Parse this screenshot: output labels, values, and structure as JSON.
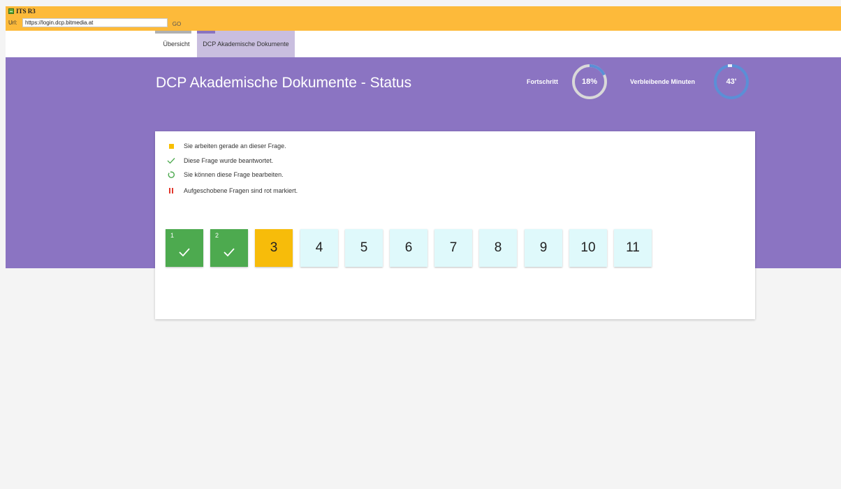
{
  "app": {
    "title": "ITS R3",
    "url_label": "Url:",
    "url_value": "https://login.dcp.bitmedia.at",
    "go_label": "GO"
  },
  "nav": {
    "tabs": [
      {
        "label": "Übersicht"
      },
      {
        "label": "DCP Akademische Dokumente",
        "active": true
      }
    ]
  },
  "header": {
    "title": "DCP Akademische Dokumente - Status",
    "progress_label": "Fortschritt",
    "progress_value": "18%",
    "progress_fraction": 0.18,
    "minutes_label": "Verbleibende Minuten",
    "minutes_value": "43'"
  },
  "legend": [
    {
      "icon": "yellow-square-icon",
      "text": "Sie arbeiten gerade an dieser Frage."
    },
    {
      "icon": "check-icon",
      "text": "Diese Frage wurde beantwortet."
    },
    {
      "icon": "redo-icon",
      "text": "Sie können diese Frage bearbeiten."
    },
    {
      "icon": "pause-icon",
      "text": "Aufgeschobene Fragen sind rot markiert."
    }
  ],
  "questions": [
    {
      "num": "1",
      "status": "answered"
    },
    {
      "num": "2",
      "status": "answered"
    },
    {
      "num": "3",
      "status": "current"
    },
    {
      "num": "4",
      "status": "open"
    },
    {
      "num": "5",
      "status": "open"
    },
    {
      "num": "6",
      "status": "open"
    },
    {
      "num": "7",
      "status": "open"
    },
    {
      "num": "8",
      "status": "open"
    },
    {
      "num": "9",
      "status": "open"
    },
    {
      "num": "10",
      "status": "open"
    },
    {
      "num": "11",
      "status": "open"
    }
  ],
  "colors": {
    "app_bar": "#fdba3a",
    "banner": "#8b74c2",
    "active_tab": "#c9bedf",
    "answered": "#4daa4f",
    "current": "#f7bc0a",
    "open": "#dff9fb",
    "gauge_track": "#d9d9d9",
    "gauge_fill": "#5b8fd6"
  }
}
